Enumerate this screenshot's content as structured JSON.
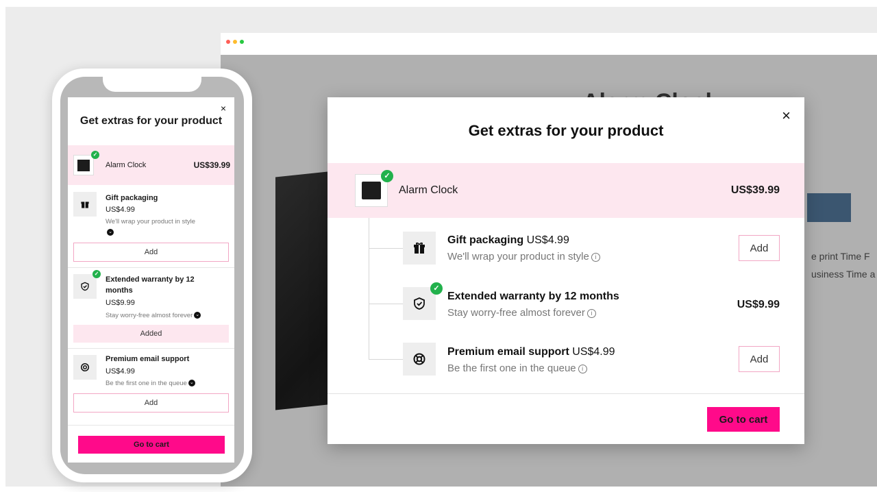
{
  "background_page": {
    "title": "Alarm Clock",
    "text_line_1": "e print Time F",
    "text_line_2": "usiness Time a"
  },
  "modal": {
    "title": "Get extras for your product",
    "close_label": "×",
    "product": {
      "name": "Alarm Clock",
      "price": "US$39.99",
      "selected": true
    },
    "addons": [
      {
        "name": "Gift packaging",
        "price": "US$4.99",
        "description": "We'll wrap your product in style",
        "action": "Add",
        "added": false,
        "icon": "gift-icon"
      },
      {
        "name": "Extended warranty by 12 months",
        "price": "US$9.99",
        "description": "Stay worry-free almost forever",
        "action": "Added",
        "added": true,
        "icon": "shield-check-icon"
      },
      {
        "name": "Premium email support",
        "price": "US$4.99",
        "description": "Be the first one in the queue",
        "action": "Add",
        "added": false,
        "icon": "lifebuoy-icon"
      }
    ],
    "cart_label": "Go to cart"
  },
  "colors": {
    "accent": "#ff0a8a",
    "highlight_row": "#fde7ef",
    "check_green": "#22b14c",
    "add_border": "#f2a6c4"
  }
}
